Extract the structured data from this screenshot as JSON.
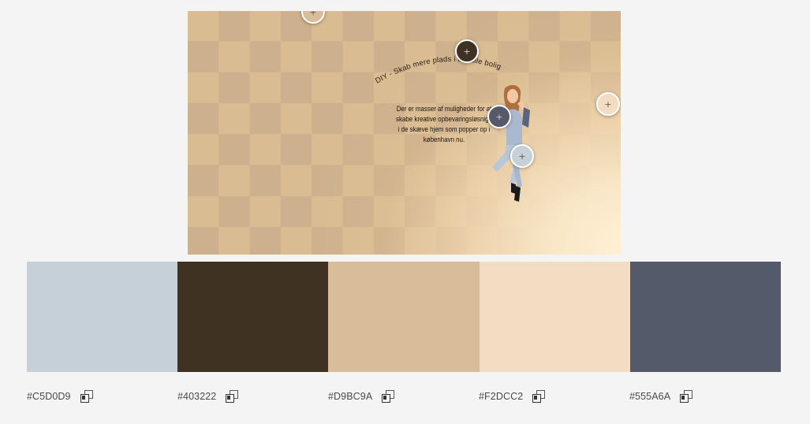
{
  "artwork": {
    "headline": "DIY - Skab mere plads i din lille bolig",
    "body_lines": [
      "Der er masser af muligheder for at",
      "skabe kreative opbevaringsløsnige",
      "i de skæve hjem som popper op i",
      "københavn nu."
    ]
  },
  "picker_pin_icon": "+",
  "picker_pins": [
    {
      "name": "pin-color-1",
      "color": "#D9BC9A"
    },
    {
      "name": "pin-color-2",
      "color": "#403222"
    },
    {
      "name": "pin-color-3",
      "color": "#F2DCC2"
    },
    {
      "name": "pin-color-4",
      "color": "#555A6A"
    },
    {
      "name": "pin-color-5",
      "color": "#C5D0D9"
    }
  ],
  "palette": [
    {
      "hex": "#C5D0D9",
      "color": "#C5D0D9"
    },
    {
      "hex": "#403222",
      "color": "#403222"
    },
    {
      "hex": "#D9BC9A",
      "color": "#D9BC9A"
    },
    {
      "hex": "#F2DCC2",
      "color": "#F2DCC2"
    },
    {
      "hex": "#555A6A",
      "color": "#555A6A"
    }
  ],
  "copy_icon": "copy-icon"
}
